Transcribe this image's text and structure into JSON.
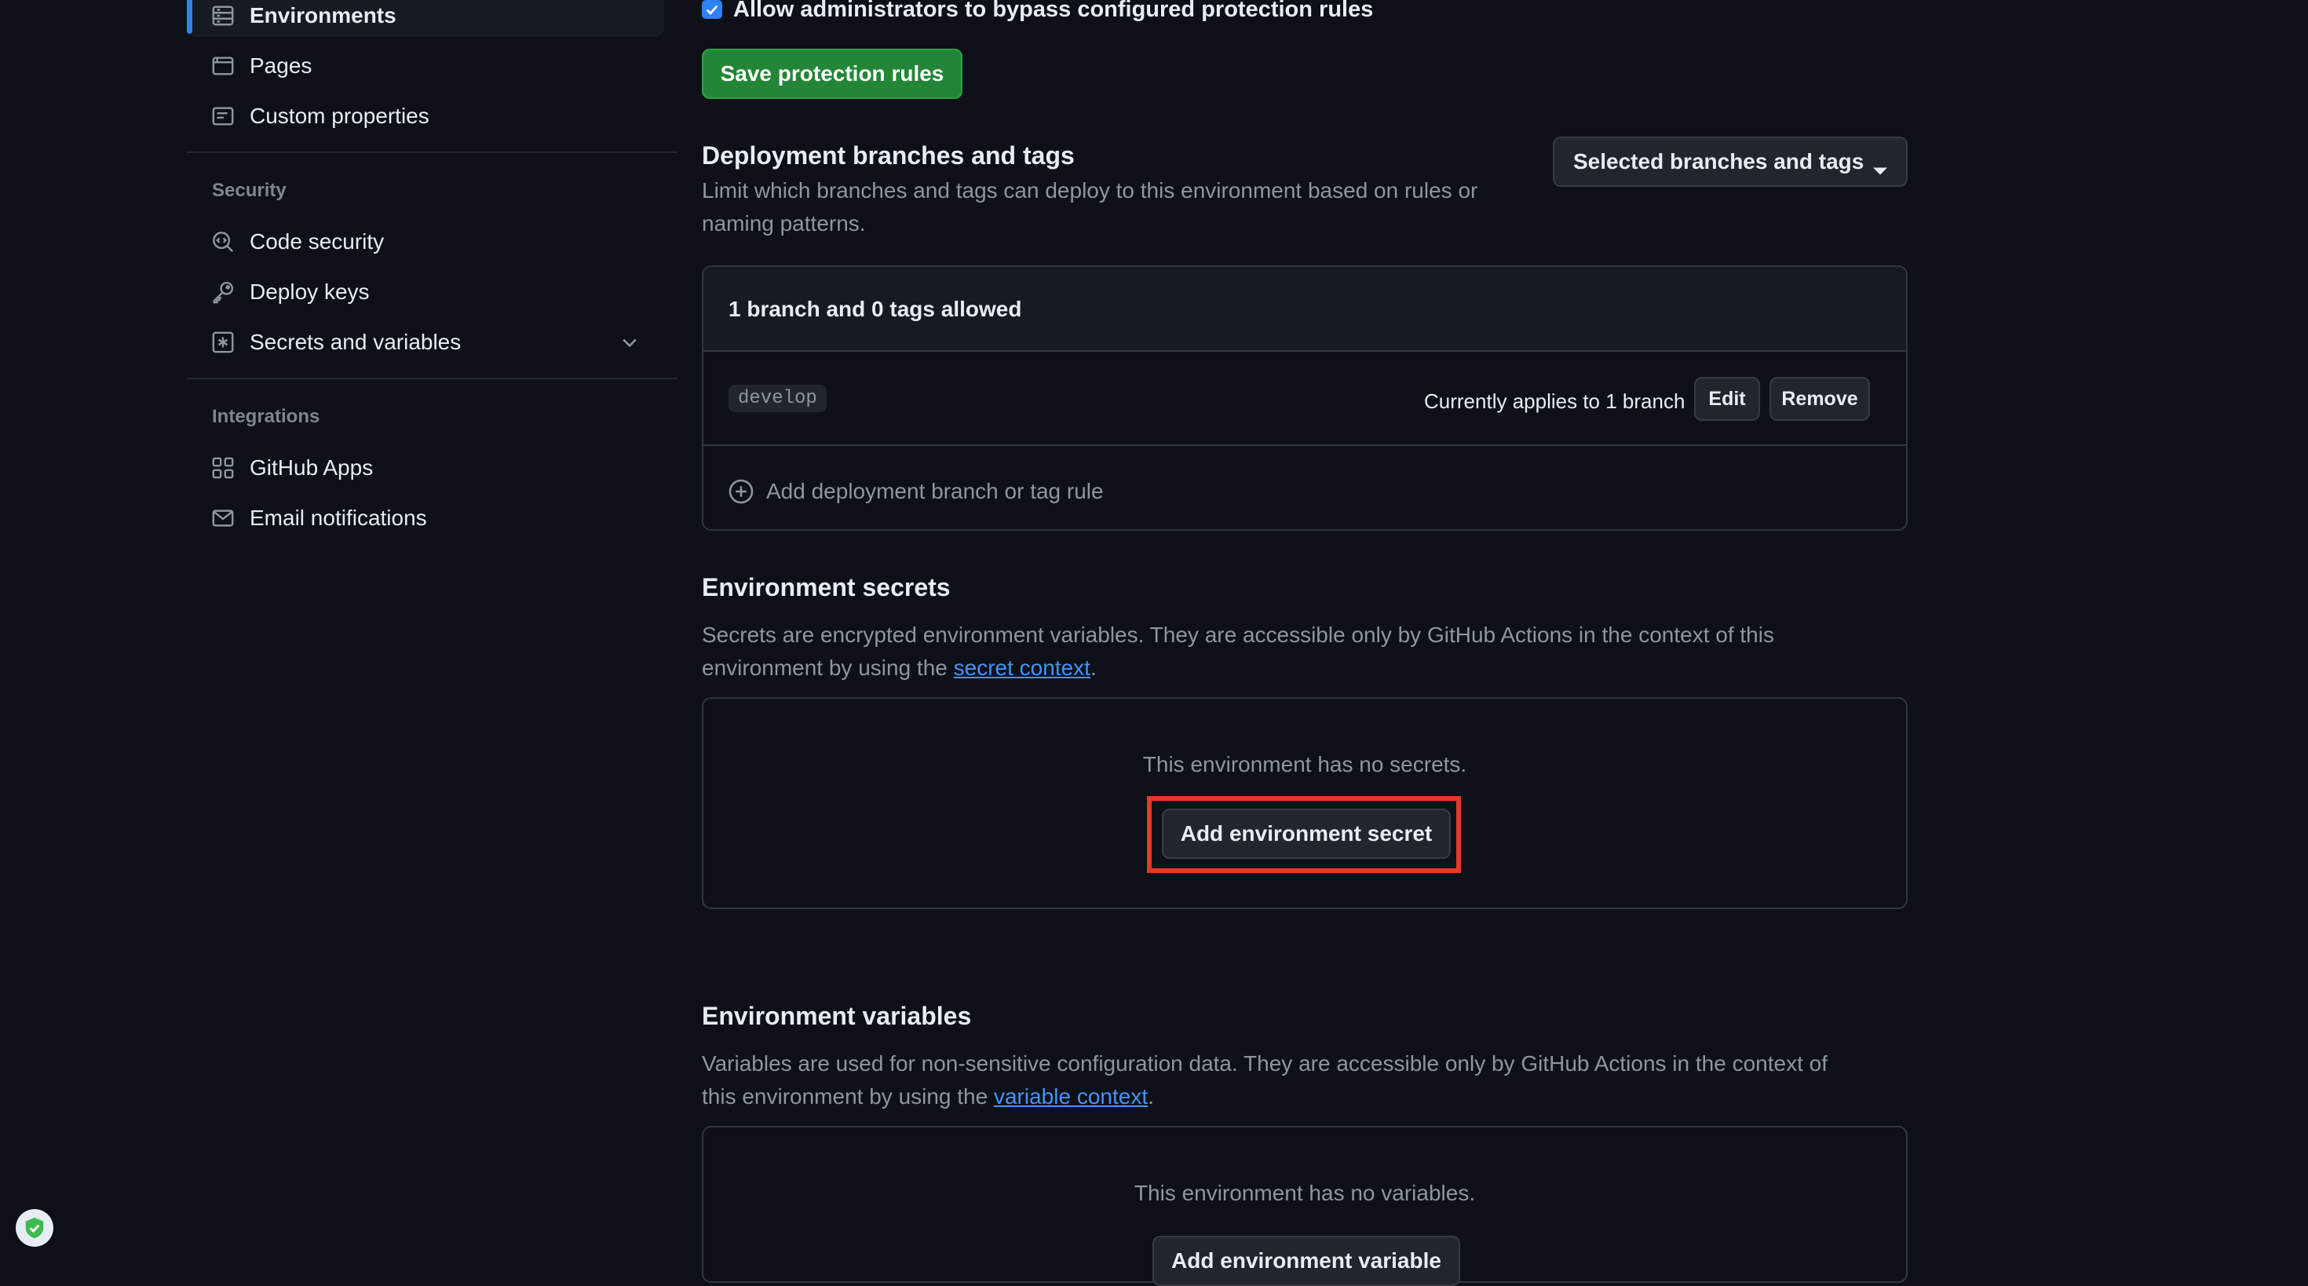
{
  "sidebar": {
    "items_top": [
      {
        "label": "Environments",
        "icon": "server-icon",
        "active": true
      },
      {
        "label": "Pages",
        "icon": "browser-icon"
      },
      {
        "label": "Custom properties",
        "icon": "note-icon"
      }
    ],
    "security": {
      "heading": "Security",
      "items": [
        {
          "label": "Code security",
          "icon": "codescan-icon"
        },
        {
          "label": "Deploy keys",
          "icon": "key-icon"
        },
        {
          "label": "Secrets and variables",
          "icon": "key-asterisk-icon",
          "expandable": true
        }
      ]
    },
    "integrations": {
      "heading": "Integrations",
      "items": [
        {
          "label": "GitHub Apps",
          "icon": "apps-icon"
        },
        {
          "label": "Email notifications",
          "icon": "mail-icon"
        }
      ]
    }
  },
  "protection": {
    "bypass_label": "Allow administrators to bypass configured protection rules",
    "bypass_checked": true,
    "save_button": "Save protection rules"
  },
  "deployment": {
    "title": "Deployment branches and tags",
    "description_line1": "Limit which branches and tags can deploy to this environment based on rules or",
    "description_line2": "naming patterns.",
    "dropdown_value": "Selected branches and tags",
    "panel_header": "1 branch and 0 tags allowed",
    "rule": {
      "name": "develop",
      "applies": "Currently applies to 1 branch",
      "edit": "Edit",
      "remove": "Remove"
    },
    "add_rule": "Add deployment branch or tag rule"
  },
  "secrets": {
    "title": "Environment secrets",
    "desc_line1": "Secrets are encrypted environment variables. They are accessible only by GitHub Actions in the context of this",
    "desc_line2_prefix": "environment by using the ",
    "desc_link": "secret context",
    "desc_suffix": ".",
    "empty": "This environment has no secrets.",
    "add_button": "Add environment secret"
  },
  "variables": {
    "title": "Environment variables",
    "desc_line1": "Variables are used for non-sensitive configuration data. They are accessible only by GitHub Actions in the context of",
    "desc_line2_prefix": "this environment by using the ",
    "desc_link": "variable context",
    "desc_suffix": ".",
    "empty": "This environment has no variables.",
    "add_button": "Add environment variable"
  },
  "colors": {
    "background": "#0d1117",
    "accent_blue": "#2f81f7",
    "save_green": "#238636",
    "highlight_red": "#e5392a"
  }
}
